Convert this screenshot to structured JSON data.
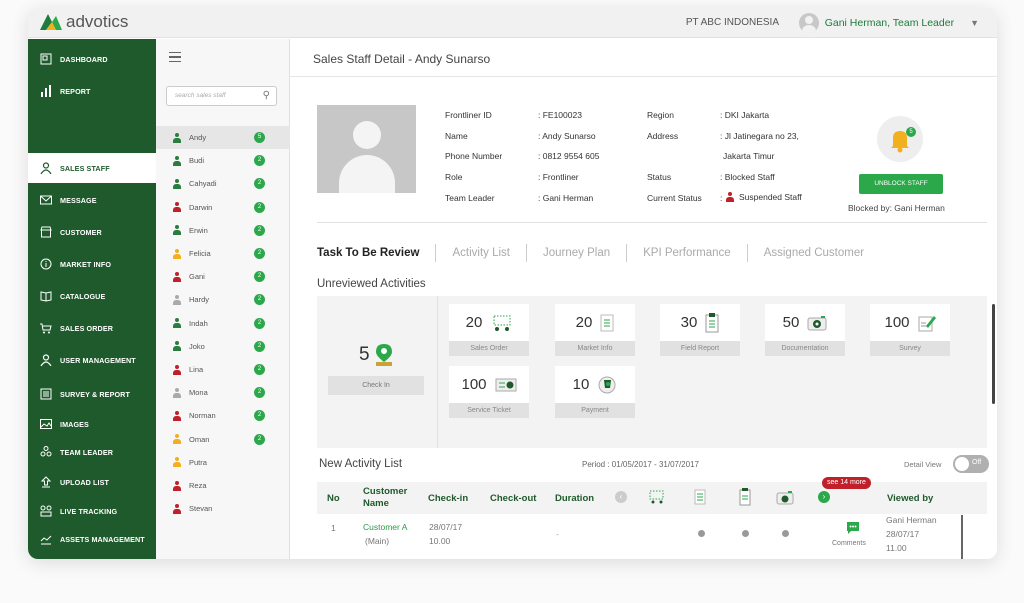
{
  "app": {
    "logo": "advotics",
    "company": "PT ABC INDONESIA",
    "user": "Gani Herman, Team Leader"
  },
  "colors": {
    "brand": "#1f5a2c",
    "accent": "#2aa84a",
    "alert": "#c0202a"
  },
  "sidebar": {
    "items": [
      {
        "label": "DASHBOARD",
        "icon": "dashboard-icon"
      },
      {
        "label": "REPORT",
        "icon": "bar-chart-icon"
      },
      {
        "label": "SALES STAFF",
        "icon": "person-icon",
        "active": true
      },
      {
        "label": "MESSAGE",
        "icon": "envelope-icon"
      },
      {
        "label": "CUSTOMER",
        "icon": "store-icon"
      },
      {
        "label": "MARKET INFO",
        "icon": "info-icon"
      },
      {
        "label": "CATALOGUE",
        "icon": "book-icon"
      },
      {
        "label": "SALES ORDER",
        "icon": "cart-icon"
      },
      {
        "label": "USER MANAGEMENT",
        "icon": "person-icon"
      },
      {
        "label": "SURVEY & REPORT",
        "icon": "clipboard-icon"
      },
      {
        "label": "IMAGES",
        "icon": "image-icon"
      },
      {
        "label": "TEAM LEADER",
        "icon": "team-icon"
      },
      {
        "label": "UPLOAD LIST",
        "icon": "upload-icon"
      },
      {
        "label": "LIVE TRACKING",
        "icon": "tracking-icon"
      },
      {
        "label": "ASSETS MANAGEMENT",
        "icon": "assets-icon"
      }
    ]
  },
  "staff": {
    "search_placeholder": "search sales staff",
    "list": [
      {
        "name": "Andy",
        "color": "#2a7d3e",
        "badge": "5"
      },
      {
        "name": "Budi",
        "color": "#2a7d3e",
        "badge": "2"
      },
      {
        "name": "Cahyadi",
        "color": "#2a7d3e",
        "badge": "2"
      },
      {
        "name": "Darwin",
        "color": "#c0202a",
        "badge": "2"
      },
      {
        "name": "Erwin",
        "color": "#2a7d3e",
        "badge": "2"
      },
      {
        "name": "Felicia",
        "color": "#f2b01e",
        "badge": "2"
      },
      {
        "name": "Gani",
        "color": "#c0202a",
        "badge": "2"
      },
      {
        "name": "Hardy",
        "color": "#aaaaaa",
        "badge": "2"
      },
      {
        "name": "Indah",
        "color": "#2a7d3e",
        "badge": "2"
      },
      {
        "name": "Joko",
        "color": "#2a7d3e",
        "badge": "2"
      },
      {
        "name": "Lina",
        "color": "#c0202a",
        "badge": "2"
      },
      {
        "name": "Mona",
        "color": "#aaaaaa",
        "badge": "2"
      },
      {
        "name": "Norman",
        "color": "#c0202a",
        "badge": "2"
      },
      {
        "name": "Oman",
        "color": "#f2b01e",
        "badge": "2"
      },
      {
        "name": "Putra",
        "color": "#f2b01e",
        "badge": ""
      },
      {
        "name": "Reza",
        "color": "#c0202a",
        "badge": ""
      },
      {
        "name": "Stevan",
        "color": "#c0202a",
        "badge": ""
      }
    ]
  },
  "detail": {
    "title": "Sales Staff Detail - Andy Sunarso",
    "frontliner_id_label": "Frontliner ID",
    "frontliner_id": ": FE100023",
    "name_label": "Name",
    "name": ": Andy Sunarso",
    "phone_label": "Phone Number",
    "phone": ": 0812 9554 605",
    "role_label": "Role",
    "role": ": Frontliner",
    "team_leader_label": "Team Leader",
    "team_leader": ": Gani Herman",
    "region_label": "Region",
    "region": ": DKI Jakarta",
    "address_label": "Address",
    "address_1": ": Jl Jatinegara no 23,",
    "address_2": "Jakarta Timur",
    "status_label": "Status",
    "status": ": Blocked Staff",
    "current_status_label": "Current Status",
    "current_status_prefix": ":",
    "current_status": "Suspended Staff",
    "bell_badge": "5",
    "unblock_label": "UNBLOCK STAFF",
    "blocked_by": "Blocked by: Gani Herman"
  },
  "tabs": [
    "Task To Be Review",
    "Activity List",
    "Journey Plan",
    "KPI Performance",
    "Assigned Customer"
  ],
  "unreviewed": {
    "title": "Unreviewed Activities",
    "checkin": {
      "count": "5",
      "label": "Check In"
    },
    "items": [
      {
        "count": "20",
        "label": "Sales Order",
        "icon": "cart-icon"
      },
      {
        "count": "20",
        "label": "Market Info",
        "icon": "document-icon"
      },
      {
        "count": "30",
        "label": "Field Report",
        "icon": "clipboard-icon"
      },
      {
        "count": "50",
        "label": "Documentation",
        "icon": "camera-icon"
      },
      {
        "count": "100",
        "label": "Survey",
        "icon": "pencil-icon"
      },
      {
        "count": "100",
        "label": "Service Ticket",
        "icon": "ticket-icon"
      },
      {
        "count": "10",
        "label": "Payment",
        "icon": "wallet-icon"
      }
    ]
  },
  "new_activity": {
    "title": "New Activity List",
    "period": "Period : 01/05/2017 - 31/07/2017",
    "detail_view": "Detail View",
    "toggle": "Off",
    "see_more": "see 14 more",
    "headers": {
      "no": "No",
      "customer_name": "Customer Name",
      "check_in": "Check-in",
      "check_out": "Check-out",
      "duration": "Duration",
      "viewed_by": "Viewed by"
    },
    "rows": [
      {
        "no": "1",
        "customer": "Customer A",
        "customer_sub": "(Main)",
        "check_in_date": "28/07/17",
        "check_in_time": "10.00",
        "duration": "-",
        "comments": "Comments",
        "viewed_name": "Gani Herman",
        "viewed_date": "28/07/17",
        "viewed_time": "11.00"
      }
    ]
  }
}
